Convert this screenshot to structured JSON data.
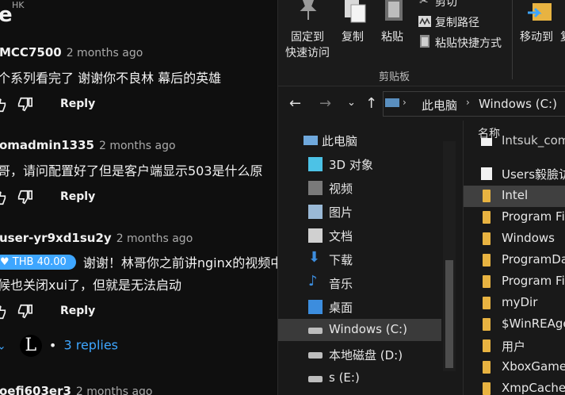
{
  "comments": {
    "header_fragment": "e",
    "hk_label": "HK",
    "items": [
      {
        "author": "MCC7500",
        "ago": "2 months ago",
        "text": "个系列看完了 谢谢你不良林 幕后的英雄",
        "reply": "Reply"
      },
      {
        "author": "omadmin1335",
        "ago": "2 months ago",
        "text": "哥，请问配置好了但是客户端显示503是什么原",
        "reply": "Reply"
      },
      {
        "author": "user-yr9xd1su2y",
        "ago": "2 months ago",
        "thanks_amount": "THB 40.00",
        "text_line1": "谢谢！林哥你之前讲nginx的视频中",
        "text_line2": "候也关闭xui了，但就是无法启动",
        "reply": "Reply",
        "replies_link": "3 replies",
        "creator_glyph": "L"
      },
      {
        "author": "oefi603er3",
        "ago": "2 months ago"
      }
    ]
  },
  "explorer": {
    "ribbon": {
      "pin_label_1": "固定到",
      "pin_label_2": "快速访问",
      "copy_label": "复制",
      "paste_label": "粘贴",
      "cut_label": "剪切",
      "copy_path_label": "复制路径",
      "paste_shortcut_label": "粘贴快捷方式",
      "moveto_label": "移动到",
      "copyto_fragment": "复",
      "group_label": "剪贴板"
    },
    "address": {
      "crumb_1": "此电脑",
      "crumb_2": "Windows (C:)"
    },
    "nav": [
      {
        "label": "此电脑",
        "icon": "pc-icon"
      },
      {
        "label": "3D 对象",
        "icon": "cube-icon"
      },
      {
        "label": "视频",
        "icon": "video-icon"
      },
      {
        "label": "图片",
        "icon": "picture-icon"
      },
      {
        "label": "文档",
        "icon": "document-icon"
      },
      {
        "label": "下载",
        "icon": "download-icon"
      },
      {
        "label": "音乐",
        "icon": "music-icon"
      },
      {
        "label": "桌面",
        "icon": "desktop-icon"
      },
      {
        "label": "Windows (C:)",
        "icon": "drive-icon"
      },
      {
        "label": "本地磁盘 (D:)",
        "icon": "drive-icon"
      },
      {
        "label": "s (E:)",
        "icon": "drive-icon"
      }
    ],
    "column_header": "名称",
    "files": [
      {
        "name": "Intsuk_com",
        "type": "file"
      },
      {
        "name": "Users毅臉访",
        "type": "file"
      },
      {
        "name": "Intel",
        "type": "folder"
      },
      {
        "name": "Program Fil",
        "type": "folder"
      },
      {
        "name": "Windows",
        "type": "folder"
      },
      {
        "name": "ProgramDa",
        "type": "folder"
      },
      {
        "name": "Program Fil",
        "type": "folder"
      },
      {
        "name": "myDir",
        "type": "folder"
      },
      {
        "name": "$WinREAge",
        "type": "folder"
      },
      {
        "name": "用户",
        "type": "folder"
      },
      {
        "name": "XboxGames",
        "type": "folder"
      },
      {
        "name": "XmpCache",
        "type": "folder"
      }
    ]
  },
  "colors": {
    "accent_blue": "#3ea6ff",
    "folder": "#e8b341",
    "explorer_bg": "#191919",
    "youtube_bg": "#0f0f0f"
  }
}
